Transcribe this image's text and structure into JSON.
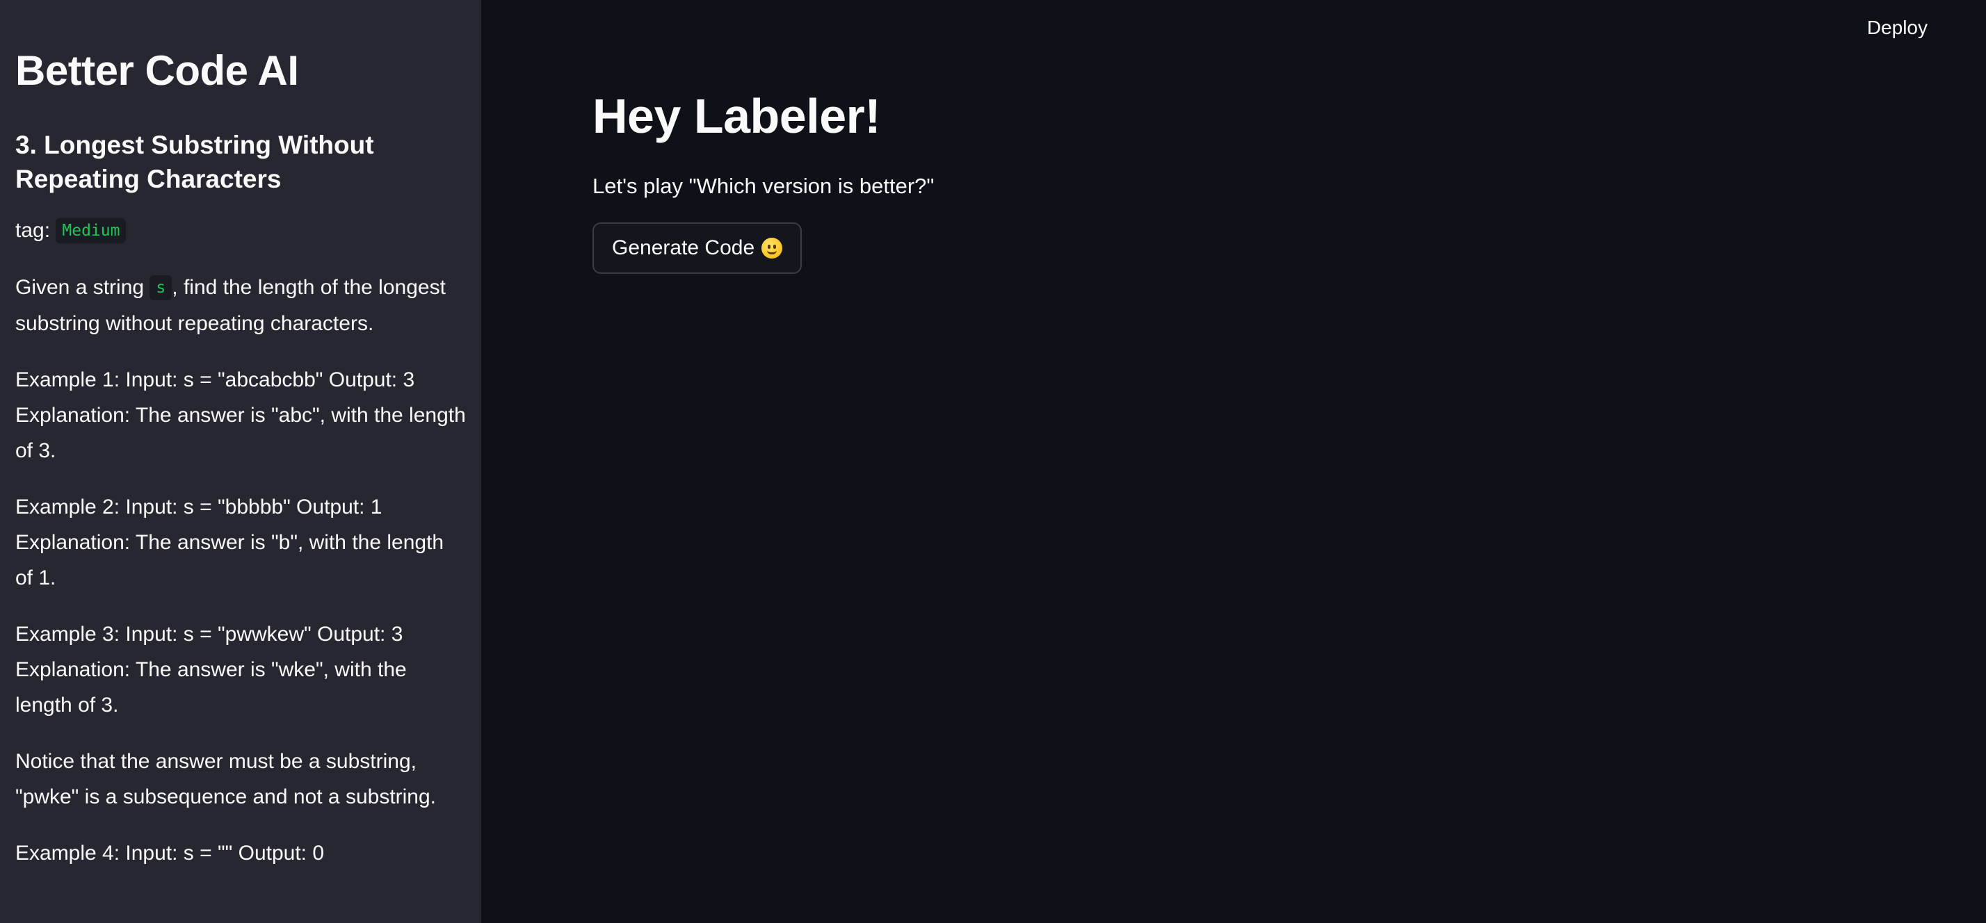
{
  "sidebar": {
    "app_title": "Better Code AI",
    "problem_title": "3. Longest Substring Without Repeating Characters",
    "tag_label": "tag:",
    "tag_value": "Medium",
    "description_pre": "Given a string ",
    "description_code": "s",
    "description_post": ", find the length of the longest substring without repeating characters.",
    "paragraphs": [
      "Example 1: Input: s = \"abcabcbb\" Output: 3 Explanation: The answer is \"abc\", with the length of 3.",
      "Example 2: Input: s = \"bbbbb\" Output: 1 Explanation: The answer is \"b\", with the length of 1.",
      "Example 3: Input: s = \"pwwkew\" Output: 3 Explanation: The answer is \"wke\", with the length of 3.",
      "Notice that the answer must be a substring, \"pwke\" is a subsequence and not a substring.",
      "Example 4: Input: s = \"\" Output: 0"
    ]
  },
  "header": {
    "deploy_label": "Deploy"
  },
  "main": {
    "heading": "Hey Labeler!",
    "subtitle": "Let's play \"Which version is better?\"",
    "generate_button_label": "Generate Code",
    "generate_button_icon": "smiling-face-icon"
  },
  "colors": {
    "background": "#0e1117",
    "sidebar_background": "#262730",
    "text": "#fafafa",
    "code_text": "#21c354"
  }
}
